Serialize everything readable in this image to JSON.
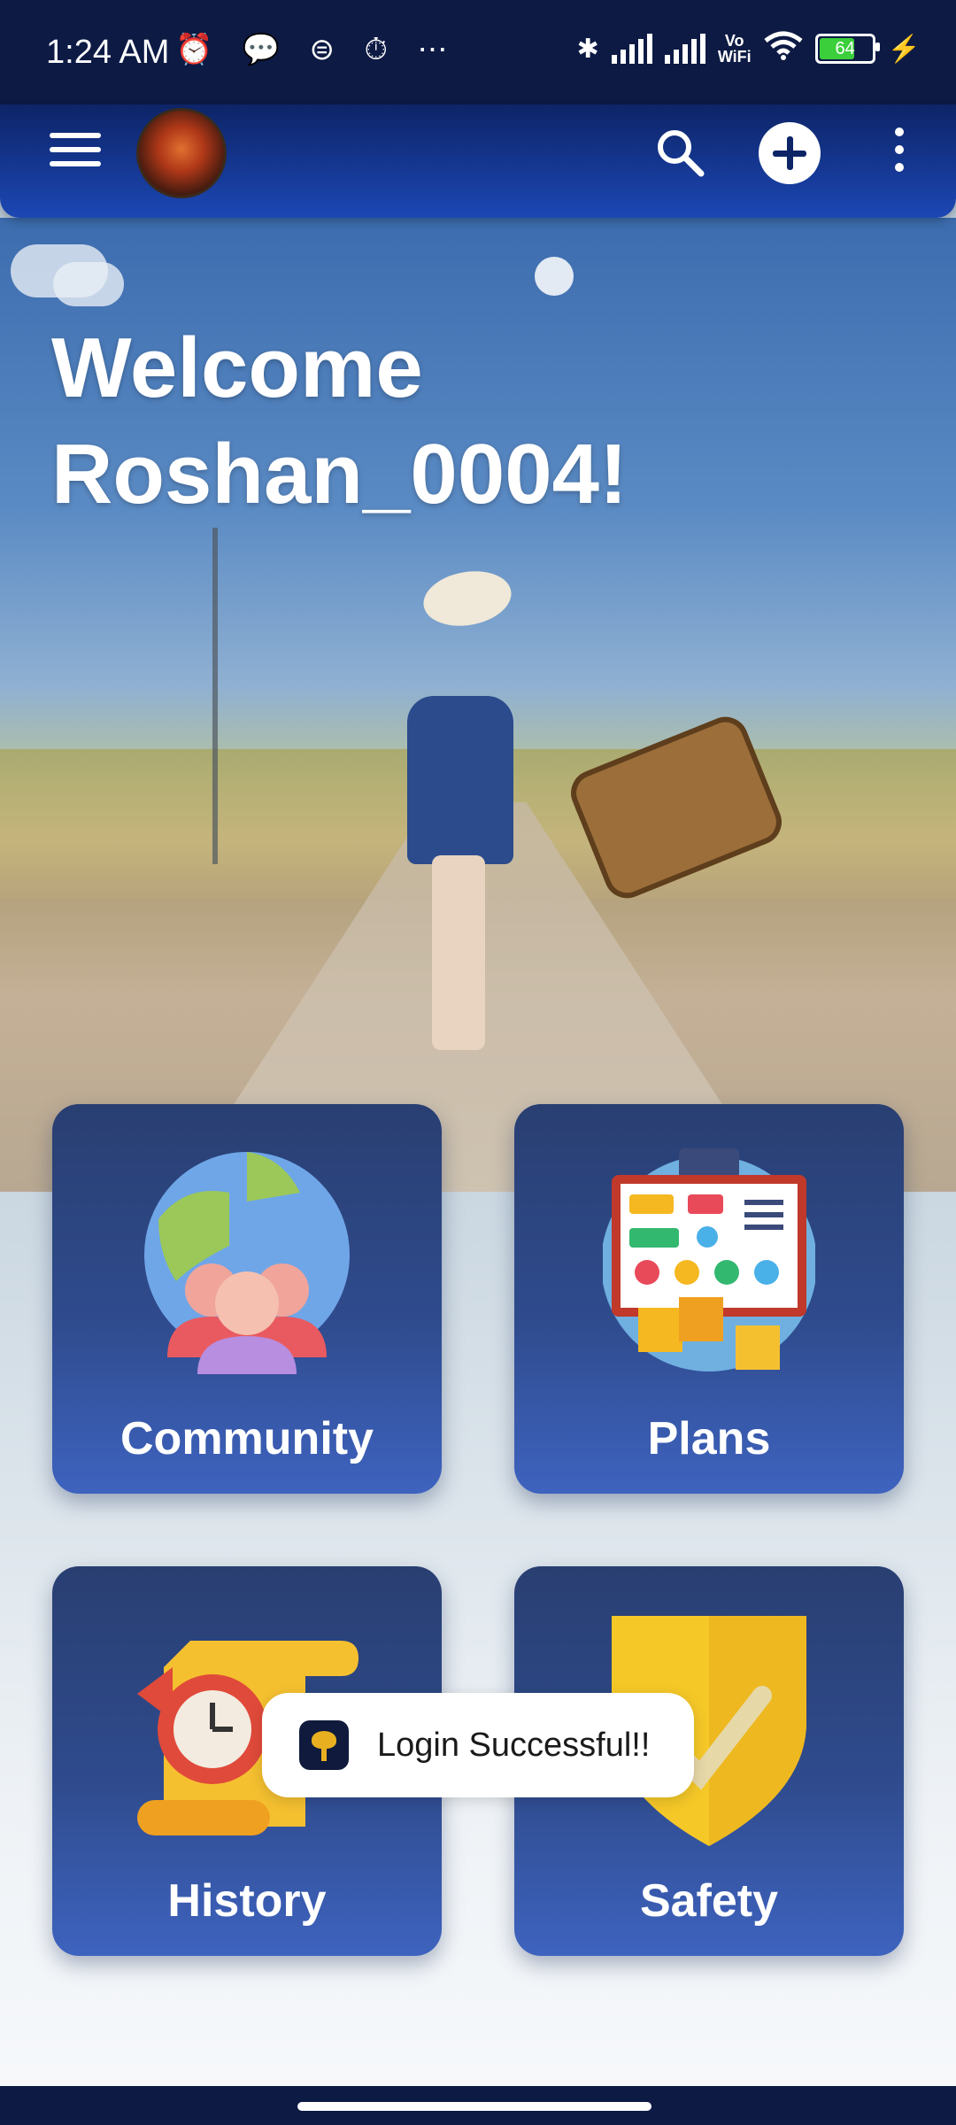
{
  "status_bar": {
    "time": "1:24 AM",
    "left_icons": [
      "alarm-icon",
      "chat-icon",
      "app-icon",
      "alarm-clock-icon",
      "more-dots"
    ],
    "left_icons_glyphs": "⏰ 💬 ⊜ ⏱ ⋯",
    "vo_wifi_top": "Vo",
    "vo_wifi_bottom": "WiFi",
    "battery_level": "64"
  },
  "app_bar": {
    "menu_icon": "menu-icon",
    "avatar": "avatar",
    "search_icon": "search-icon",
    "add_icon": "add-icon",
    "more_icon": "more-vert-icon"
  },
  "hero": {
    "welcome_line1": "Welcome",
    "welcome_line2": "Roshan_0004!"
  },
  "cards": {
    "community": "Community",
    "plans": "Plans",
    "history": "History",
    "safety": "Safety"
  },
  "toast": {
    "message": "Login Successful!!"
  },
  "colors": {
    "app_bar": "#1c47b4",
    "card_top": "#293f72",
    "card_bottom": "#3e63bf",
    "status_bar": "#0c1a44"
  }
}
